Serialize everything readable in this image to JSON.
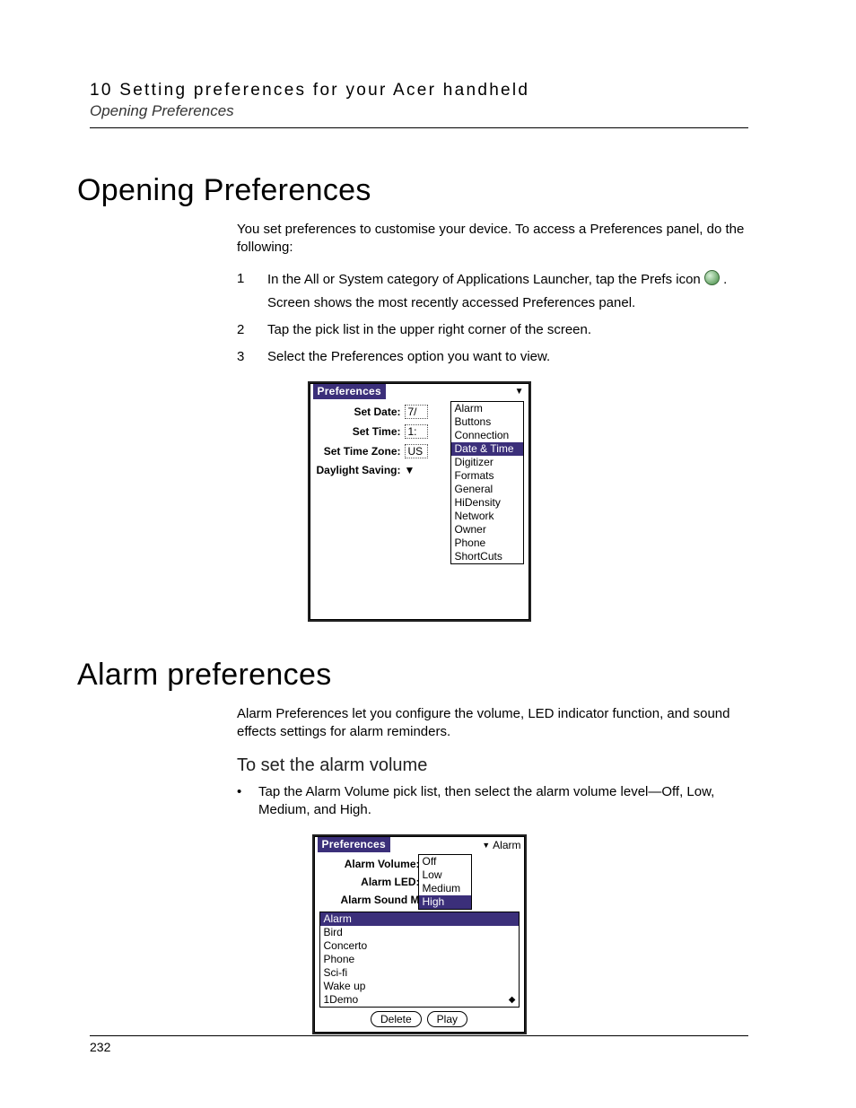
{
  "header": {
    "chapter": "10 Setting preferences for your Acer handheld",
    "section": "Opening Preferences"
  },
  "h1": "Opening Preferences",
  "intro": "You set preferences to customise your device. To access a Preferences panel, do the following:",
  "steps": [
    {
      "n": "1",
      "text_before_icon": "In the All or System category of Applications Launcher, tap the Prefs icon ",
      "text_after_icon": ".",
      "sub": "Screen shows the most recently accessed Preferences panel."
    },
    {
      "n": "2",
      "text": "Tap the pick list in the upper right corner of the screen."
    },
    {
      "n": "3",
      "text": "Select the Preferences option you want to view."
    }
  ],
  "palm1": {
    "title": "Preferences",
    "rows": {
      "set_date": {
        "label": "Set Date:",
        "value": "7/"
      },
      "set_time": {
        "label": "Set Time:",
        "value": "1:"
      },
      "set_tz": {
        "label": "Set Time Zone:",
        "value": "US"
      },
      "dst": {
        "label": "Daylight Saving:",
        "value": "▼"
      }
    },
    "picklist": [
      "Alarm",
      "Buttons",
      "Connection",
      "Date & Time",
      "Digitizer",
      "Formats",
      "General",
      "HiDensity",
      "Network",
      "Owner",
      "Phone",
      "ShortCuts"
    ],
    "selected": "Date & Time"
  },
  "h2": "Alarm preferences",
  "alarm_intro": "Alarm Preferences let you configure the volume, LED indicator function, and sound effects settings for alarm reminders.",
  "sub_heading": "To set the alarm volume",
  "bullet": "Tap the Alarm Volume pick list, then select the alarm volume level—Off, Low, Medium, and High.",
  "palm2": {
    "title": "Preferences",
    "title_right": "Alarm",
    "rows": {
      "volume": "Alarm Volume:",
      "led": "Alarm LED:",
      "sound": "Alarm Sound M"
    },
    "volume_options": [
      "Off",
      "Low",
      "Medium",
      "High"
    ],
    "volume_selected": "High",
    "sounds": [
      "Alarm",
      "Bird",
      "Concerto",
      "Phone",
      "Sci-fi",
      "Wake up",
      "1Demo"
    ],
    "sound_selected": "Alarm",
    "buttons": {
      "delete": "Delete",
      "play": "Play"
    }
  },
  "page_number": "232"
}
